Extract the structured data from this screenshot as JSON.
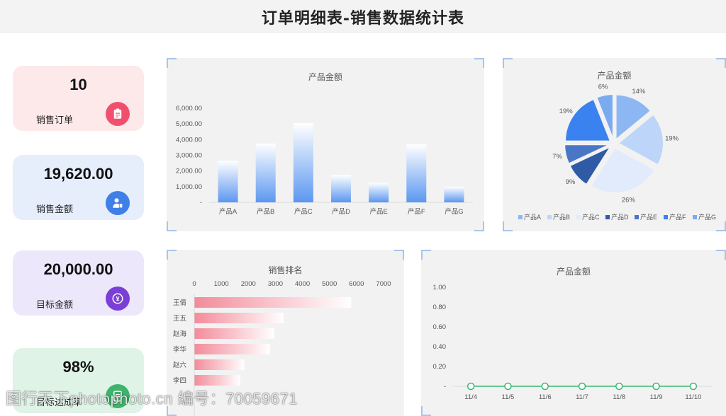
{
  "page_title": "订单明细表-销售数据统计表",
  "kpis": [
    {
      "value": "10",
      "label": "销售订单",
      "icon": "clipboard-icon",
      "bg": "#fde8ea",
      "icon_color": "#f0506e"
    },
    {
      "value": "19,620.00",
      "label": "销售金额",
      "icon": "user-money-icon",
      "bg": "#e6edfb",
      "icon_color": "#3f7fe6"
    },
    {
      "value": "20,000.00",
      "label": "目标金额",
      "icon": "target-exchange-icon",
      "bg": "#ece7fb",
      "icon_color": "#7b3fd6"
    },
    {
      "value": "98%",
      "label": "目标达成率",
      "icon": "document-icon",
      "bg": "#dff3e7",
      "icon_color": "#3db36b"
    }
  ],
  "watermark": "图行天下photophoto.cn 编号：70059671",
  "chart_data": [
    {
      "type": "bar",
      "title": "产品金额",
      "categories": [
        "产品A",
        "产品B",
        "产品C",
        "产品D",
        "产品E",
        "产品F",
        "产品G"
      ],
      "values": [
        2650,
        3750,
        5050,
        1750,
        1250,
        3700,
        1000
      ],
      "ylim": [
        0,
        6000
      ],
      "yticks": [
        "-",
        "1,000.00",
        "2,000.00",
        "3,000.00",
        "4,000.00",
        "5,000.00",
        "6,000.00"
      ],
      "color": "#5b97f0"
    },
    {
      "type": "pie",
      "title": "产品金额",
      "categories": [
        "产品A",
        "产品B",
        "产品C",
        "产品D",
        "产品E",
        "产品F",
        "产品G"
      ],
      "values": [
        14,
        19,
        26,
        9,
        7,
        19,
        6
      ],
      "labels": [
        "14%",
        "19%",
        "26%",
        "9%",
        "7%",
        "19%",
        "6%"
      ],
      "colors": [
        "#8db7f3",
        "#bcd5f8",
        "#e2ebfb",
        "#2f5aa6",
        "#4a76c6",
        "#3a82ef",
        "#7aaaf0"
      ]
    },
    {
      "type": "bar",
      "orientation": "horizontal",
      "title": "销售排名",
      "categories": [
        "王倩",
        "王五",
        "赵海",
        "李华",
        "赵六",
        "李四"
      ],
      "values": [
        5800,
        3300,
        2950,
        2800,
        1850,
        1700
      ],
      "xlim": [
        0,
        7000
      ],
      "xticks": [
        "0",
        "1000",
        "2000",
        "3000",
        "4000",
        "5000",
        "6000",
        "7000"
      ],
      "color": "#f38b9a"
    },
    {
      "type": "line",
      "title": "产品金额",
      "x": [
        "11/4",
        "11/5",
        "11/6",
        "11/7",
        "11/8",
        "11/9",
        "11/10"
      ],
      "values": [
        0,
        0,
        0,
        0,
        0,
        0,
        0
      ],
      "ylim": [
        0,
        1
      ],
      "yticks": [
        "-",
        "0.20",
        "0.40",
        "0.60",
        "0.80",
        "1.00"
      ],
      "color": "#3bb873"
    }
  ]
}
